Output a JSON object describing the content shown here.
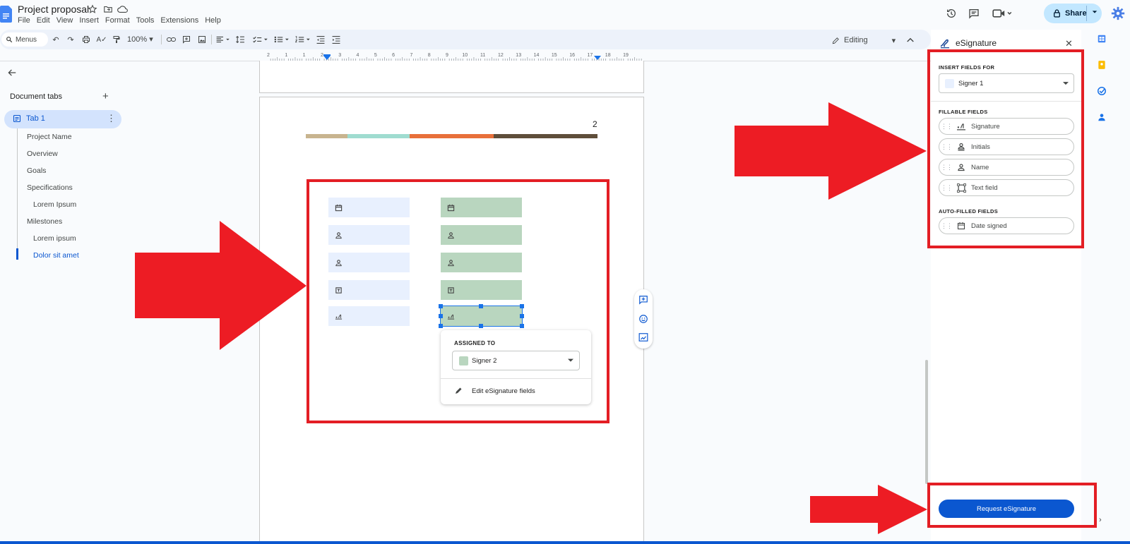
{
  "title_bar": {
    "doc_title": "Project proposal",
    "menu": [
      "File",
      "Edit",
      "View",
      "Insert",
      "Format",
      "Tools",
      "Extensions",
      "Help"
    ],
    "share_label": "Share"
  },
  "toolbar": {
    "menus_search": "Menus",
    "zoom": "100%",
    "editing_mode": "Editing"
  },
  "ruler": {
    "labels": [
      "2",
      "1",
      "1",
      "2",
      "3",
      "4",
      "5",
      "6",
      "7",
      "8",
      "9",
      "10",
      "11",
      "12",
      "13",
      "14",
      "15",
      "16",
      "17",
      "18",
      "19"
    ]
  },
  "sidebar": {
    "title": "Document tabs",
    "tab": "Tab 1",
    "outline": [
      {
        "label": "Project Name",
        "level": 1,
        "active": false
      },
      {
        "label": "Overview",
        "level": 1,
        "active": false
      },
      {
        "label": "Goals",
        "level": 1,
        "active": false
      },
      {
        "label": "Specifications",
        "level": 1,
        "active": false
      },
      {
        "label": "Lorem Ipsum",
        "level": 2,
        "active": false
      },
      {
        "label": "Milestones",
        "level": 1,
        "active": false
      },
      {
        "label": "Lorem ipsum",
        "level": 2,
        "active": false
      },
      {
        "label": "Dolor sit amet",
        "level": 2,
        "active": true
      }
    ]
  },
  "document": {
    "page_number": "2",
    "stripe_colors": [
      "#c8b48f",
      "#9fdcd0",
      "#e8703a",
      "#5f4e3a"
    ],
    "signer1_fields": [
      "date",
      "person",
      "person",
      "text",
      "signature"
    ],
    "signer2_fields": [
      "date",
      "person",
      "person",
      "text",
      "signature"
    ],
    "popup": {
      "label": "ASSIGNED TO",
      "signer": "Signer 2",
      "edit_action": "Edit eSignature fields"
    }
  },
  "esignature_panel": {
    "title": "eSignature",
    "insert_for_label": "INSERT FIELDS FOR",
    "signer": "Signer 1",
    "fillable_label": "FILLABLE FIELDS",
    "fillable_fields": [
      {
        "label": "Signature",
        "icon": "signature-icon"
      },
      {
        "label": "Initials",
        "icon": "initials-icon"
      },
      {
        "label": "Name",
        "icon": "person-icon"
      },
      {
        "label": "Text field",
        "icon": "text-field-icon"
      }
    ],
    "auto_label": "AUTO-FILLED FIELDS",
    "auto_fields": [
      {
        "label": "Date signed",
        "icon": "calendar-icon"
      }
    ],
    "request_button": "Request eSignature"
  },
  "colors": {
    "signer1": "#e8f0fe",
    "signer2": "#b9d6bf",
    "accent": "#0b57d0",
    "annotation": "#ed1c24"
  }
}
